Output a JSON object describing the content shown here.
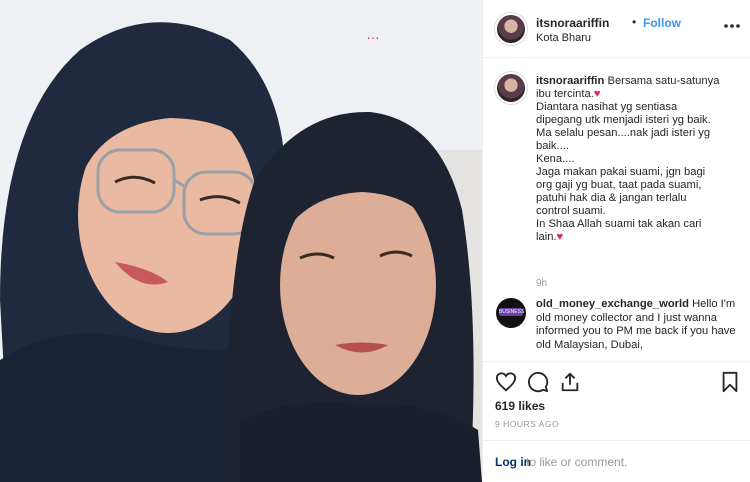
{
  "post": {
    "username": "itsnoraariffin",
    "separator": "•",
    "follow_label": "Follow",
    "location": "Kota Bharu",
    "menu_icon": "ellipsis-icon",
    "photo_menu_glyph": "…"
  },
  "caption": {
    "username": "itsnoraariffin",
    "line1": "Bersama satu-satunya",
    "line2": "ibu tercinta.",
    "body": "Diantara nasihat yg sentiasa\ndipegang utk menjadi isteri yg baik.\nMa selalu pesan....nak jadi isteri yg\nbaik....\nKena....\nJaga makan pakai suami, jgn bagi\norg gaji yg buat, taat pada suami,\npatuhi hak dia & jangan terlalu\ncontrol suami.\nIn Shaa Allah suami tak akan cari\nlain.",
    "heart": "♥",
    "time": "9h"
  },
  "comment2": {
    "username": "old_money_exchange_world",
    "text": "Hello I'm old money collector and I just wanna informed you to PM me back if you have old Malaysian, Dubai,",
    "avatar_text": "BUSINESS"
  },
  "actions": {
    "icons": [
      "heart-icon",
      "comment-icon",
      "share-icon",
      "bookmark-icon"
    ]
  },
  "likes": "619 likes",
  "posted_ago": "9 HOURS AGO",
  "login": {
    "link": "Log in",
    "rest": "to like or comment."
  },
  "colors": {
    "link_blue": "#3897f0",
    "heart_red": "#e0245e",
    "muted": "#999999",
    "border": "#efefef"
  }
}
